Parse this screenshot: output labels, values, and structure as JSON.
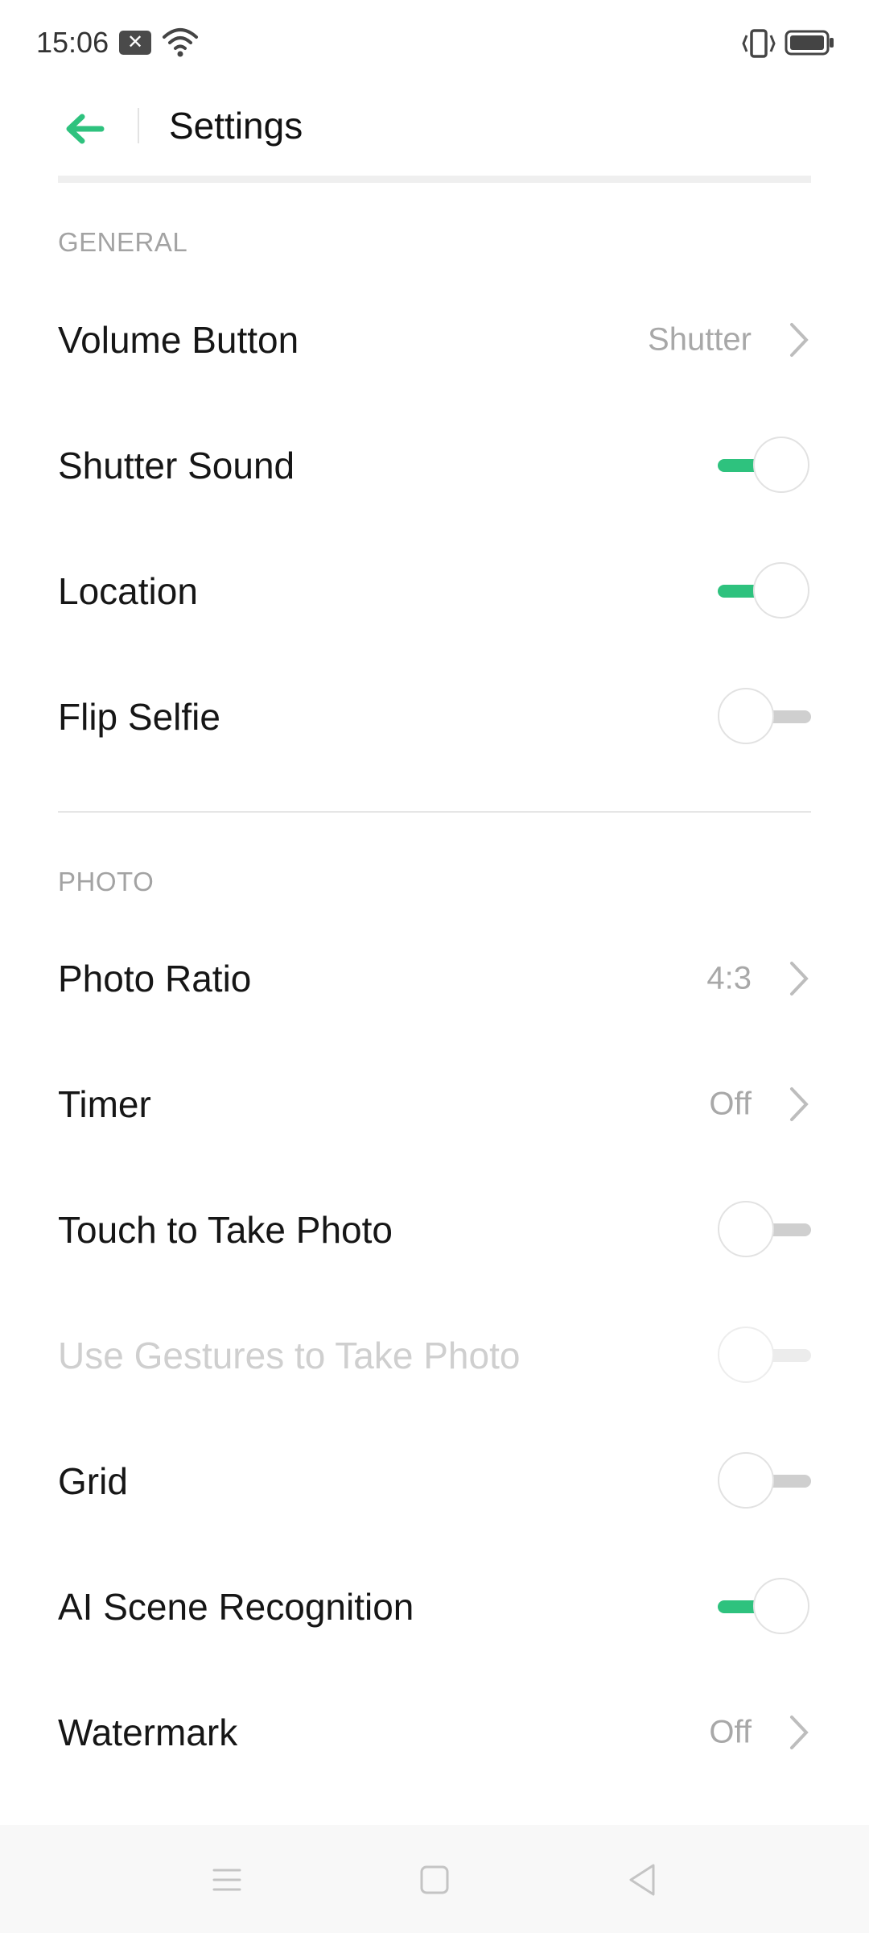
{
  "status_bar": {
    "time": "15:06",
    "notification_icon": "close-notification-icon",
    "icons": [
      "wifi-icon",
      "vibrate-icon",
      "battery-icon"
    ]
  },
  "header": {
    "title": "Settings",
    "back_icon": "arrow-left-icon",
    "accent_color": "#2ec27e"
  },
  "sections": {
    "general": {
      "title": "GENERAL",
      "items": [
        {
          "label": "Volume Button",
          "type": "link",
          "value": "Shutter"
        },
        {
          "label": "Shutter Sound",
          "type": "toggle",
          "on": true
        },
        {
          "label": "Location",
          "type": "toggle",
          "on": true
        },
        {
          "label": "Flip Selfie",
          "type": "toggle",
          "on": false
        }
      ]
    },
    "photo": {
      "title": "PHOTO",
      "items": [
        {
          "label": "Photo Ratio",
          "type": "link",
          "value": "4:3"
        },
        {
          "label": "Timer",
          "type": "link",
          "value": "Off"
        },
        {
          "label": "Touch to Take Photo",
          "type": "toggle",
          "on": false
        },
        {
          "label": "Use Gestures to Take Photo",
          "type": "toggle",
          "on": false,
          "disabled": true
        },
        {
          "label": "Grid",
          "type": "toggle",
          "on": false
        },
        {
          "label": "AI Scene Recognition",
          "type": "toggle",
          "on": true
        },
        {
          "label": "Watermark",
          "type": "link",
          "value": "Off"
        }
      ]
    }
  },
  "nav_bar": {
    "icons": [
      "menu-icon",
      "home-icon",
      "back-triangle-icon"
    ]
  }
}
